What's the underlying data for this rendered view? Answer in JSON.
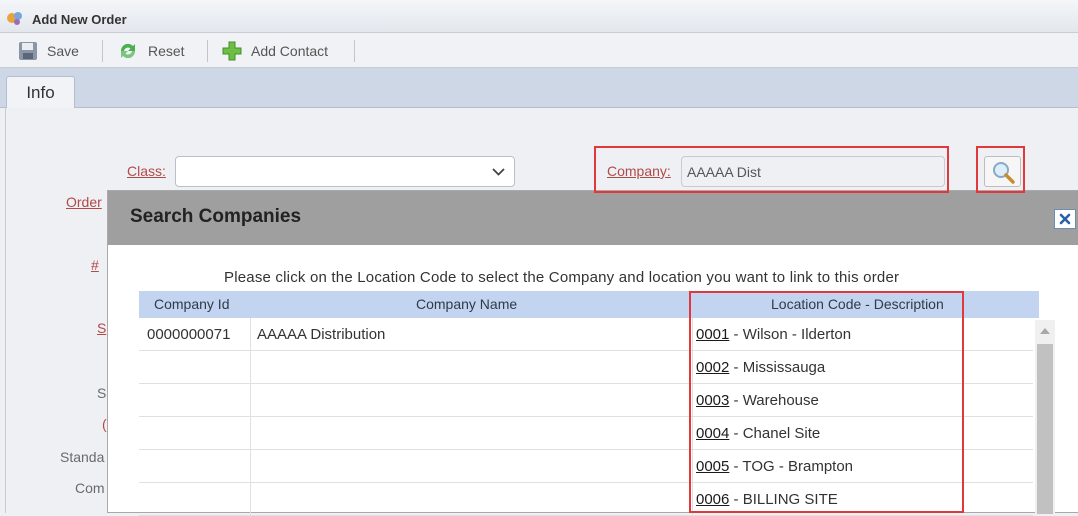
{
  "window": {
    "title": "Add New Order",
    "logo_icon": "app-logo-icon"
  },
  "toolbar": {
    "save_label": "Save",
    "reset_label": "Reset",
    "add_contact_label": "Add Contact"
  },
  "tabs": [
    {
      "label": "Info"
    }
  ],
  "form": {
    "class_label": "Class:",
    "class_value": "",
    "company_label": "Company:",
    "company_value": "AAAAA Dist",
    "partial_labels": {
      "order": "Order",
      "hash": "#",
      "s1": "S",
      "s2": "S",
      "small": "(",
      "standard": "Standa",
      "com": "Com"
    }
  },
  "modal": {
    "title": "Search Companies",
    "close_icon": "close-icon",
    "instructions": "Please click on the Location Code to select the Company and location you want to link to this order",
    "columns": [
      "Company Id",
      "Company Name",
      "Location Code - Description"
    ],
    "rows": [
      {
        "company_id": "0000000071",
        "company_name": "AAAAA Distribution",
        "code": "0001",
        "description": " - Wilson - Ilderton"
      },
      {
        "company_id": "",
        "company_name": "",
        "code": "0002",
        "description": " - Mississauga"
      },
      {
        "company_id": "",
        "company_name": "",
        "code": "0003",
        "description": " - Warehouse"
      },
      {
        "company_id": "",
        "company_name": "",
        "code": "0004",
        "description": " - Chanel Site"
      },
      {
        "company_id": "",
        "company_name": "",
        "code": "0005",
        "description": " - TOG - Brampton"
      },
      {
        "company_id": "",
        "company_name": "",
        "code": "0006",
        "description": " - BILLING SITE"
      }
    ]
  },
  "colors": {
    "highlight": "#e0383b",
    "link_label": "#b24a4a",
    "table_header": "#c2d4ef",
    "modal_header": "#9f9f9f"
  }
}
